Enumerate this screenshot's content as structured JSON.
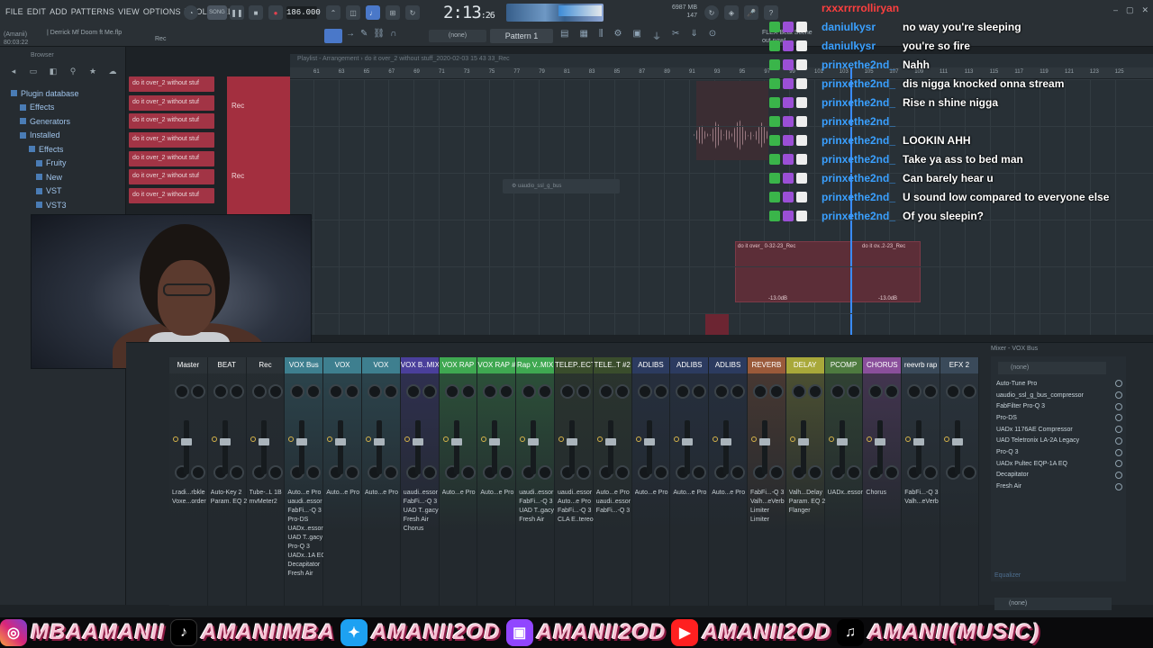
{
  "menu": [
    "FILE",
    "EDIT",
    "ADD",
    "PATTERNS",
    "VIEW",
    "OPTIONS",
    "TOOLS",
    "HELP"
  ],
  "hint": {
    "line1": "(Amanii)",
    "line2": "80:03:22"
  },
  "song_label": "| Derrick Mf Doom ft Me.flp",
  "record_label": "Rec",
  "song_mode": "SONG",
  "tempo": "186.000",
  "time_main": "2:13",
  "time_small": ":26",
  "cpu": {
    "line1": "6987 MB",
    "line2": "147"
  },
  "pattern": "Pattern 1",
  "pattern_none": "(none)",
  "hint_right": {
    "line1": "FLEX  Beat Scene",
    "line2": "out now!"
  },
  "browser": {
    "title": "Browser",
    "tree": [
      {
        "label": "Plugin database",
        "indent": 12
      },
      {
        "label": "Effects",
        "indent": 22
      },
      {
        "label": "Generators",
        "indent": 22
      },
      {
        "label": "Installed",
        "indent": 22
      },
      {
        "label": "Effects",
        "indent": 32
      },
      {
        "label": "Fruity",
        "indent": 40
      },
      {
        "label": "New",
        "indent": 40
      },
      {
        "label": "VST",
        "indent": 40
      },
      {
        "label": "VST3",
        "indent": 40
      }
    ]
  },
  "clips": [
    "do it over_2 without stuf",
    "do it over_2 without stuf",
    "do it over_2 without stuf",
    "do it over_2 without stuf",
    "do it over_2 without stuf",
    "do it over_2 without stuf",
    "do it over_2 without stuf"
  ],
  "playlist": {
    "title": "Playlist - Arrangement › do it over_2 without stuff_2020-02-03 15 43 33_Rec",
    "ticks": [
      "61",
      "63",
      "65",
      "67",
      "69",
      "71",
      "73",
      "75",
      "77",
      "79",
      "81",
      "83",
      "85",
      "87",
      "89",
      "91",
      "93",
      "95",
      "97",
      "99",
      "101",
      "103",
      "105",
      "107",
      "109",
      "111",
      "113",
      "115",
      "117",
      "119",
      "121",
      "123",
      "125"
    ],
    "ghost_window": "uaudio_ssl_g_bus",
    "clip2_a": "do it over_ 0-32-23_Rec",
    "clip2_b": "do it ov..2-23_Rec",
    "db_a": "-13.0dB",
    "db_b": "-13.0dB"
  },
  "chat": [
    {
      "user": "rxxxrrrrolliryan",
      "text": ""
    },
    {
      "user": "daniulkysr",
      "text": "no way you're sleeping"
    },
    {
      "user": "daniulkysr",
      "text": "you're so fire"
    },
    {
      "user": "prinxethe2nd_",
      "text": "Nahh"
    },
    {
      "user": "prinxethe2nd_",
      "text": "dis nigga knocked onna stream"
    },
    {
      "user": "prinxethe2nd_",
      "text": "Rise n shine nigga"
    },
    {
      "user": "prinxethe2nd_",
      "text": ""
    },
    {
      "user": "prinxethe2nd_",
      "text": "LOOKIN AHH"
    },
    {
      "user": "prinxethe2nd_",
      "text": "Take ya ass to bed man"
    },
    {
      "user": "prinxethe2nd_",
      "text": "Can barely hear u"
    },
    {
      "user": "prinxethe2nd_",
      "text": "U sound low compared to everyone else"
    },
    {
      "user": "prinxethe2nd_",
      "text": "Of you sleepin?"
    }
  ],
  "mixer": {
    "title": "Mixer - VOX Bus",
    "strips": [
      {
        "name": "Master",
        "color": "#2b3237",
        "fx": "Lradi...rbkle\nVoxe...order"
      },
      {
        "name": "BEAT",
        "color": "#2b3237",
        "fx": "Auto-Key 2\nParam. EQ 2"
      },
      {
        "name": "Rec",
        "color": "#2b3237",
        "fx": "Tube-..L 1B\nmvMeter2"
      },
      {
        "name": "VOX Bus",
        "color": "#3e7f8f",
        "fx": "Auto...e Pro\nuaudi..essor\nFabFi...-Q 3\nPro-DS\nUADx..essor\nUAD T..gacy\nPro-Q 3\nUADx..1A EQ\nDecapitator\nFresh Air"
      },
      {
        "name": "VOX",
        "color": "#3e7f8f",
        "fx": "Auto...e Pro"
      },
      {
        "name": "VOX",
        "color": "#3e7f8f",
        "fx": "Auto...e Pro"
      },
      {
        "name": "VOX B..MIX",
        "color": "#4a3f9b",
        "fx": "uaudi..essor\nFabFi...-Q 3\nUAD T..gacy\nFresh Air\nChorus"
      },
      {
        "name": "VOX RAP",
        "color": "#3fa851",
        "fx": "Auto...e Pro"
      },
      {
        "name": "VOX RAP #2",
        "color": "#3fa851",
        "fx": "Auto...e Pro"
      },
      {
        "name": "Rap V..MIX",
        "color": "#3fa851",
        "fx": "uaudi..essor\nFabFi...-Q 3\nUAD T..gacy\nFresh Air"
      },
      {
        "name": "TELEP..ECT",
        "color": "#3a4d2c",
        "fx": "uaudi..essor\nAuto...e Pro\nFabFi...-Q 3\nCLA E..tereo"
      },
      {
        "name": "TELE..T #2",
        "color": "#3a4d2c",
        "fx": "Auto...e Pro\nuaudi..essor\nFabFi...-Q 3"
      },
      {
        "name": "ADLIBS",
        "color": "#2c3b60",
        "fx": "Auto...e Pro"
      },
      {
        "name": "ADLIBS",
        "color": "#2c3b60",
        "fx": "Auto...e Pro"
      },
      {
        "name": "ADLIBS",
        "color": "#2c3b60",
        "fx": "Auto...e Pro"
      },
      {
        "name": "REVERB",
        "color": "#9a5a3a",
        "fx": "FabFi...-Q 3\nValh...eVerb\nLimiter\nLimiter"
      },
      {
        "name": "DELAY",
        "color": "#a8a83a",
        "fx": "Valh...Delay\nParam. EQ 2\nFlanger"
      },
      {
        "name": "PCOMP",
        "color": "#4e7a3f",
        "fx": "UADx..essor"
      },
      {
        "name": "CHORUS",
        "color": "#8a4f9b",
        "fx": "Chorus"
      },
      {
        "name": "reevrb rap",
        "color": "#3a4a5a",
        "fx": "FabFi...-Q 3\nValh...eVerb"
      },
      {
        "name": "EFX 2",
        "color": "#3a4a5a",
        "fx": ""
      }
    ],
    "fx_select": "(none)",
    "fx_slots": [
      "Auto-Tune Pro",
      "uaudio_ssl_g_bus_compressor",
      "FabFilter Pro-Q 3",
      "Pro-DS",
      "UADx 1176AE Compressor",
      "UAD Teletronix LA-2A Legacy",
      "Pro-Q 3",
      "UADx Pultec EQP-1A EQ",
      "Decapitator",
      "Fresh Air"
    ],
    "eq_label": "Equalizer",
    "out_label": "(none)"
  },
  "social": [
    {
      "icon": "instagram-icon",
      "handle": "MBAAMANII",
      "glyph": "◎"
    },
    {
      "icon": "tiktok-icon",
      "handle": "AMANIIMBA",
      "glyph": "♪"
    },
    {
      "icon": "twitter-icon",
      "handle": "AMANII2OD",
      "glyph": "✦"
    },
    {
      "icon": "twitch-icon",
      "handle": "AMANII2OD",
      "glyph": "▣"
    },
    {
      "icon": "youtube-icon",
      "handle": "AMANII2OD",
      "glyph": "▶"
    },
    {
      "icon": "music-note-icon",
      "handle": "AMANII(MUSIC)",
      "glyph": "♫"
    }
  ]
}
